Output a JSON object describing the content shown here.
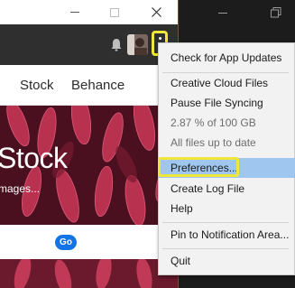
{
  "app": {
    "nav": {
      "stock": "Stock",
      "behance": "Behance"
    },
    "hero": {
      "title": "Stock",
      "subtitle": "mages..."
    },
    "search": {
      "go_label": "Go"
    }
  },
  "menu": {
    "items": [
      {
        "label": "Check for App Updates",
        "enabled": true
      },
      {
        "label": "Creative Cloud Files",
        "enabled": true
      },
      {
        "label": "Pause File Syncing",
        "enabled": true
      },
      {
        "label": "2.87 % of 100 GB",
        "enabled": false
      },
      {
        "label": "All files up to date",
        "enabled": false
      },
      {
        "label": "Preferences...",
        "enabled": true,
        "highlighted": true
      },
      {
        "label": "Create Log File",
        "enabled": true
      },
      {
        "label": "Help",
        "enabled": true
      },
      {
        "label": "Pin to Notification Area...",
        "enabled": true
      },
      {
        "label": "Quit",
        "enabled": true
      }
    ]
  },
  "colors": {
    "highlight": "#f0e53a",
    "menu_hover": "#9fc6ee",
    "header_dark": "#2f2f2f",
    "go_blue": "#1473e6"
  },
  "icons": [
    "bell-icon",
    "more-vertical-icon",
    "minimize-icon",
    "maximize-icon",
    "close-icon",
    "restore-icon"
  ]
}
